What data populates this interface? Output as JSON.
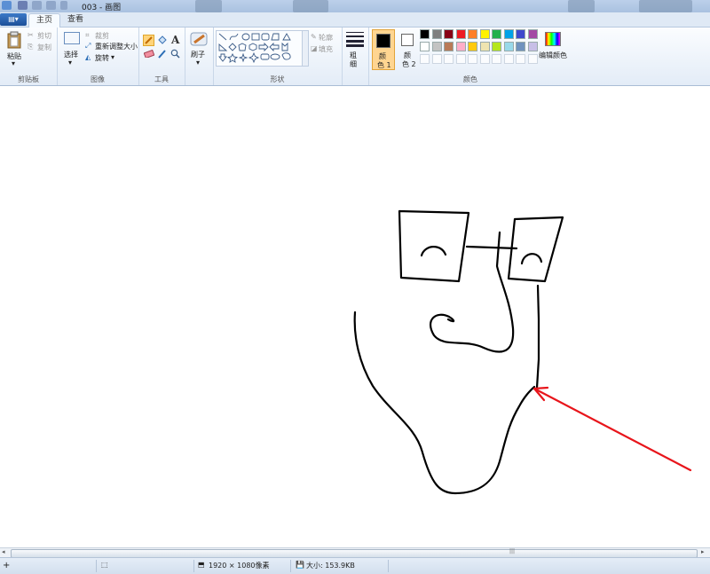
{
  "titlebar": {
    "title": "003 - 画图"
  },
  "tabs": {
    "menu_label": "▤▾",
    "home": "主页",
    "view": "查看"
  },
  "clipboard": {
    "paste": "粘贴",
    "cut": "剪切",
    "copy": "复制",
    "group": "剪贴板"
  },
  "image": {
    "select": "选择",
    "crop": "裁剪",
    "resize": "重新调整大小",
    "rotate": "旋转",
    "group": "图像"
  },
  "tools": {
    "text_tool": "A",
    "group": "工具"
  },
  "brushes": {
    "label": "刷子"
  },
  "shapes": {
    "outline": "轮廓",
    "fill": "填充",
    "group": "形状"
  },
  "size": {
    "label_line1": "粗",
    "label_line2": "细"
  },
  "colors": {
    "color1_line1": "颜",
    "color1_line2": "色 1",
    "color2_line1": "颜",
    "color2_line2": "色 2",
    "edit": "编辑颜色",
    "group": "颜色",
    "palette_row1": [
      "#000000",
      "#7f7f7f",
      "#880015",
      "#ed1c24",
      "#ff7f27",
      "#fff200",
      "#22b14c",
      "#00a2e8",
      "#3f48cc",
      "#a349a4"
    ],
    "palette_row2": [
      "#ffffff",
      "#c3c3c3",
      "#b97a57",
      "#ffaec9",
      "#ffc90e",
      "#efe4b0",
      "#b5e61d",
      "#99d9ea",
      "#7092be",
      "#c8bfe7"
    ],
    "color1": "#000000",
    "color2": "#ffffff",
    "arrow_color": "#e8151b"
  },
  "status": {
    "dimensions": "1920 × 1080像素",
    "size": "大小: 153.9KB"
  }
}
